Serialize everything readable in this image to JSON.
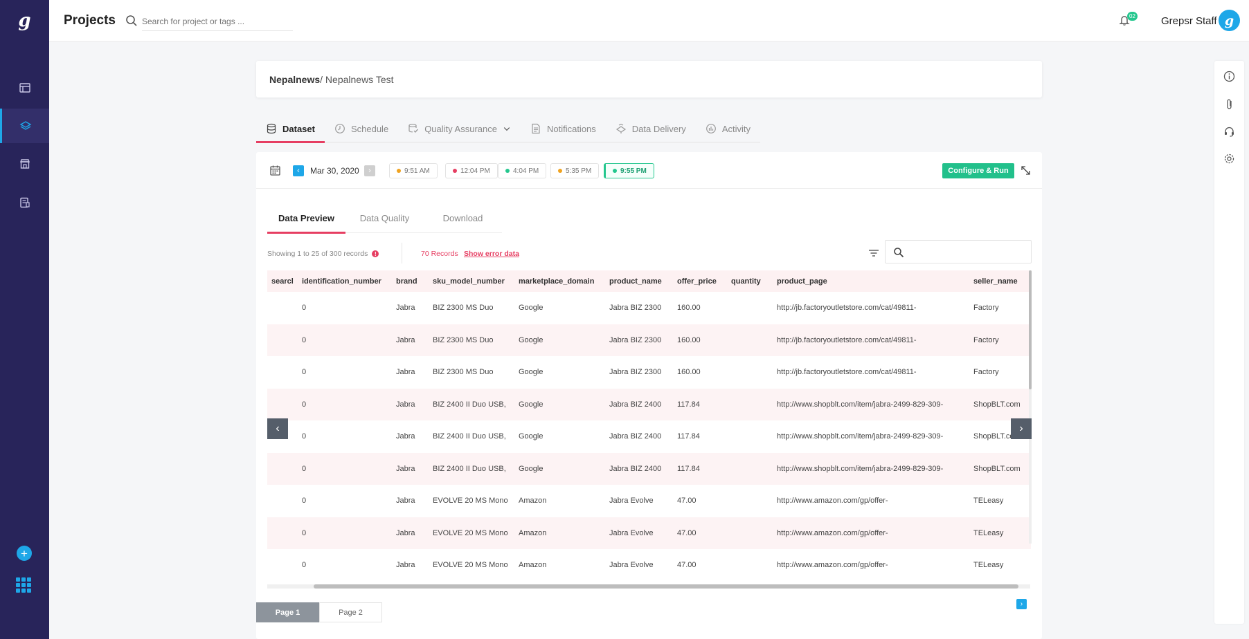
{
  "app": {
    "logo": "g",
    "title": "Projects",
    "search_placeholder": "Search for project or tags ...",
    "notifications_count": "02",
    "user_name": "Grepsr Staff",
    "avatar_letter": "g"
  },
  "sidebar": {
    "items": [
      {
        "icon": "layout-icon"
      },
      {
        "icon": "layers-icon"
      },
      {
        "icon": "store-icon"
      },
      {
        "icon": "report-icon"
      }
    ],
    "add_label": "+",
    "apps_icon": "apps-grid-icon"
  },
  "breadcrumb": {
    "parent": "Nepalnews",
    "separator": "/ ",
    "current": "Nepalnews Test"
  },
  "main_tabs": [
    {
      "label": "Dataset",
      "icon": "database-icon",
      "active": true
    },
    {
      "label": "Schedule",
      "icon": "clock-icon"
    },
    {
      "label": "Quality Assurance",
      "icon": "qa-icon"
    },
    {
      "label": "Notifications",
      "icon": "document-icon"
    },
    {
      "label": "Data Delivery",
      "icon": "delivery-icon"
    },
    {
      "label": "Activity",
      "icon": "activity-icon"
    }
  ],
  "toolbar": {
    "date": "Mar 30, 2020",
    "runs": [
      {
        "time": "9:51 AM",
        "color": "#f0a320"
      },
      {
        "time": "12:04 PM",
        "color": "#e63e62"
      },
      {
        "time": "4:04 PM",
        "color": "#24c78e"
      },
      {
        "time": "5:35 PM",
        "color": "#f0a320"
      },
      {
        "time": "9:55 PM",
        "color": "#24c78e",
        "active": true
      }
    ],
    "configure_label": "Configure & Run"
  },
  "sub_tabs": [
    {
      "label": "Data Preview",
      "active": true
    },
    {
      "label": "Data Quality"
    },
    {
      "label": "Download"
    }
  ],
  "records": {
    "showing": "Showing 1 to 25 of 300 records",
    "error_count": "70 Records",
    "show_error": "Show error data"
  },
  "table": {
    "columns": [
      "searcl",
      "identification_number",
      "brand",
      "sku_model_number",
      "marketplace_domain",
      "product_name",
      "offer_price",
      "quantity",
      "product_page",
      "seller_name"
    ],
    "rows": [
      [
        "",
        "0",
        "Jabra",
        "BIZ 2300 MS Duo",
        "Google",
        "Jabra BIZ 2300",
        "160.00",
        "",
        "http://jb.factoryoutletstore.com/cat/49811-",
        "Factory"
      ],
      [
        "",
        "0",
        "Jabra",
        "BIZ 2300 MS Duo",
        "Google",
        "Jabra BIZ 2300",
        "160.00",
        "",
        "http://jb.factoryoutletstore.com/cat/49811-",
        "Factory"
      ],
      [
        "",
        "0",
        "Jabra",
        "BIZ 2300 MS Duo",
        "Google",
        "Jabra BIZ 2300",
        "160.00",
        "",
        "http://jb.factoryoutletstore.com/cat/49811-",
        "Factory"
      ],
      [
        "",
        "0",
        "Jabra",
        "BIZ 2400 II Duo USB,",
        "Google",
        "Jabra BIZ 2400",
        "117.84",
        "",
        "http://www.shopblt.com/item/jabra-2499-829-309-",
        "ShopBLT.com"
      ],
      [
        "",
        "0",
        "Jabra",
        "BIZ 2400 II Duo USB,",
        "Google",
        "Jabra BIZ 2400",
        "117.84",
        "",
        "http://www.shopblt.com/item/jabra-2499-829-309-",
        "ShopBLT.com"
      ],
      [
        "",
        "0",
        "Jabra",
        "BIZ 2400 II Duo USB,",
        "Google",
        "Jabra BIZ 2400",
        "117.84",
        "",
        "http://www.shopblt.com/item/jabra-2499-829-309-",
        "ShopBLT.com"
      ],
      [
        "",
        "0",
        "Jabra",
        "EVOLVE 20 MS Mono",
        "Amazon",
        "Jabra Evolve",
        "47.00",
        "",
        "http://www.amazon.com/gp/offer-",
        "TELeasy"
      ],
      [
        "",
        "0",
        "Jabra",
        "EVOLVE 20 MS Mono",
        "Amazon",
        "Jabra Evolve",
        "47.00",
        "",
        "http://www.amazon.com/gp/offer-",
        "TELeasy"
      ],
      [
        "",
        "0",
        "Jabra",
        "EVOLVE 20 MS Mono",
        "Amazon",
        "Jabra Evolve",
        "47.00",
        "",
        "http://www.amazon.com/gp/offer-",
        "TELeasy"
      ]
    ]
  },
  "pagination": {
    "pages": [
      "Page 1",
      "Page 2"
    ],
    "active": "Page 1"
  },
  "right_rail": [
    "info-icon",
    "attachment-icon",
    "headset-icon",
    "settings-icon"
  ],
  "colors": {
    "sidebar": "#28245a",
    "accent": "#1ea7e8",
    "tab_underline": "#e63e62",
    "primary_button": "#22c08b"
  }
}
